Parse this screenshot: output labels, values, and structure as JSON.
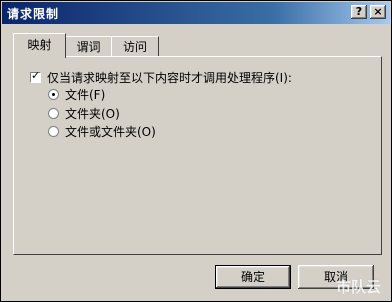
{
  "window": {
    "title": "请求限制",
    "help_label": "?",
    "close_label": "×"
  },
  "tabs": [
    {
      "label": "映射",
      "active": true
    },
    {
      "label": "谓词",
      "active": false
    },
    {
      "label": "访问",
      "active": false
    }
  ],
  "mapping": {
    "checkbox_label": "仅当请求映射至以下内容时才调用处理程序(I):",
    "checkbox_checked": true,
    "options": [
      {
        "label": "文件(F)",
        "selected": true
      },
      {
        "label": "文件夹(O)",
        "selected": false
      },
      {
        "label": "文件或文件夹(O)",
        "selected": false
      }
    ]
  },
  "buttons": {
    "ok_label": "确定",
    "cancel_label": "取消"
  },
  "watermark": {
    "text": "市队云"
  },
  "colors": {
    "titlebar": "#0a246a",
    "dialog_face": "#d4d0c8"
  }
}
